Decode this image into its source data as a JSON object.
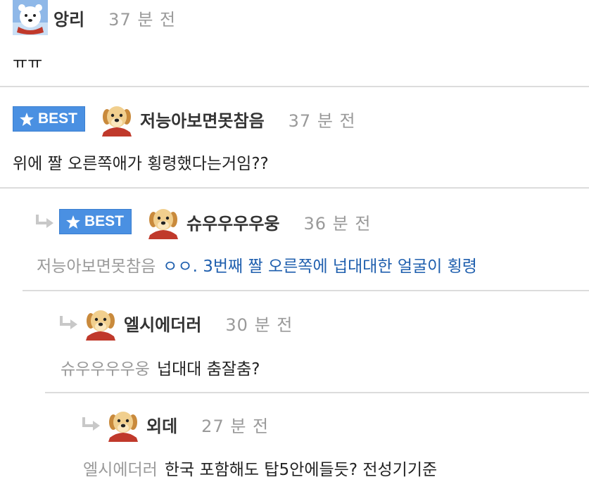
{
  "comments": [
    {
      "nickname": "앙리",
      "time": "37 분 전",
      "avatar": "polar-bear-avatar",
      "best": false,
      "mention": "",
      "text": "ㅠㅠ"
    },
    {
      "nickname": "저능아보면못참음",
      "time": "37 분 전",
      "avatar": "puppy-avatar",
      "best": true,
      "best_label": "BEST",
      "mention": "",
      "text": "위에 짤 오른쪽애가 횡령했다는거임??"
    },
    {
      "nickname": "슈우우우우웅",
      "time": "36 분 전",
      "avatar": "puppy-avatar",
      "best": true,
      "best_label": "BEST",
      "mention": "저능아보면못참음",
      "text": "ㅇㅇ. 3번째 짤 오른쪽에 넙대대한 얼굴이 횡령",
      "text_color": "#1f5fae"
    },
    {
      "nickname": "엘시에더러",
      "time": "30 분 전",
      "avatar": "puppy-avatar",
      "best": false,
      "mention": "슈우우우우웅",
      "text": "넙대대 춤잘춤?"
    },
    {
      "nickname": "외데",
      "time": "27 분 전",
      "avatar": "puppy-avatar",
      "best": false,
      "mention": "엘시에더러",
      "text": "한국 포함해도 탑5안에들듯? 전성기기준"
    }
  ],
  "colors": {
    "best_badge": "#4a90e2",
    "nickname": "#333333",
    "meta": "#9a9a9a",
    "divider": "#dcdcdc",
    "highlight_text": "#1f5fae"
  }
}
